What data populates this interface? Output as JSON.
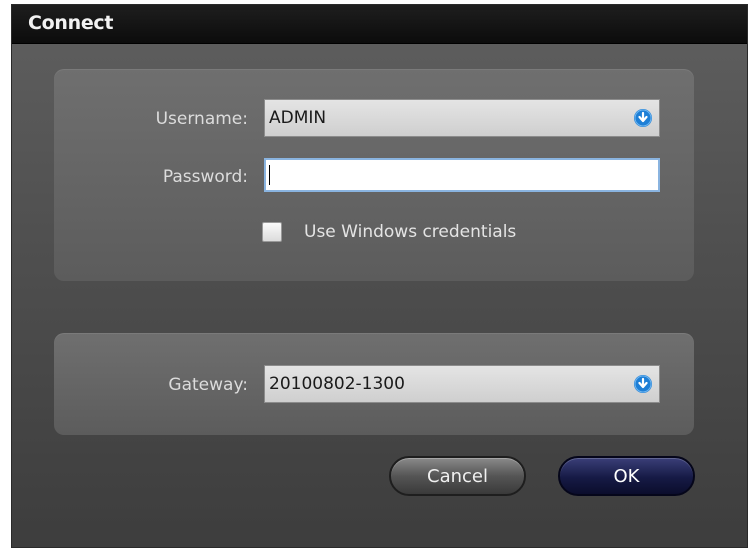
{
  "dialog": {
    "title": "Connect"
  },
  "credentials": {
    "username_label": "Username:",
    "username_value": "ADMIN",
    "password_label": "Password:",
    "password_value": "",
    "use_windows_credentials_label": "Use Windows credentials",
    "use_windows_credentials_checked": false
  },
  "gateway": {
    "label": "Gateway:",
    "value": "20100802-1300"
  },
  "buttons": {
    "cancel": "Cancel",
    "ok": "OK"
  },
  "colors": {
    "dropdown_icon": "#1e7fd6",
    "ok_button": "#161a45",
    "focus_border": "#8ab4e0"
  },
  "icons": {
    "dropdown": "chevron-down-circle-icon"
  }
}
